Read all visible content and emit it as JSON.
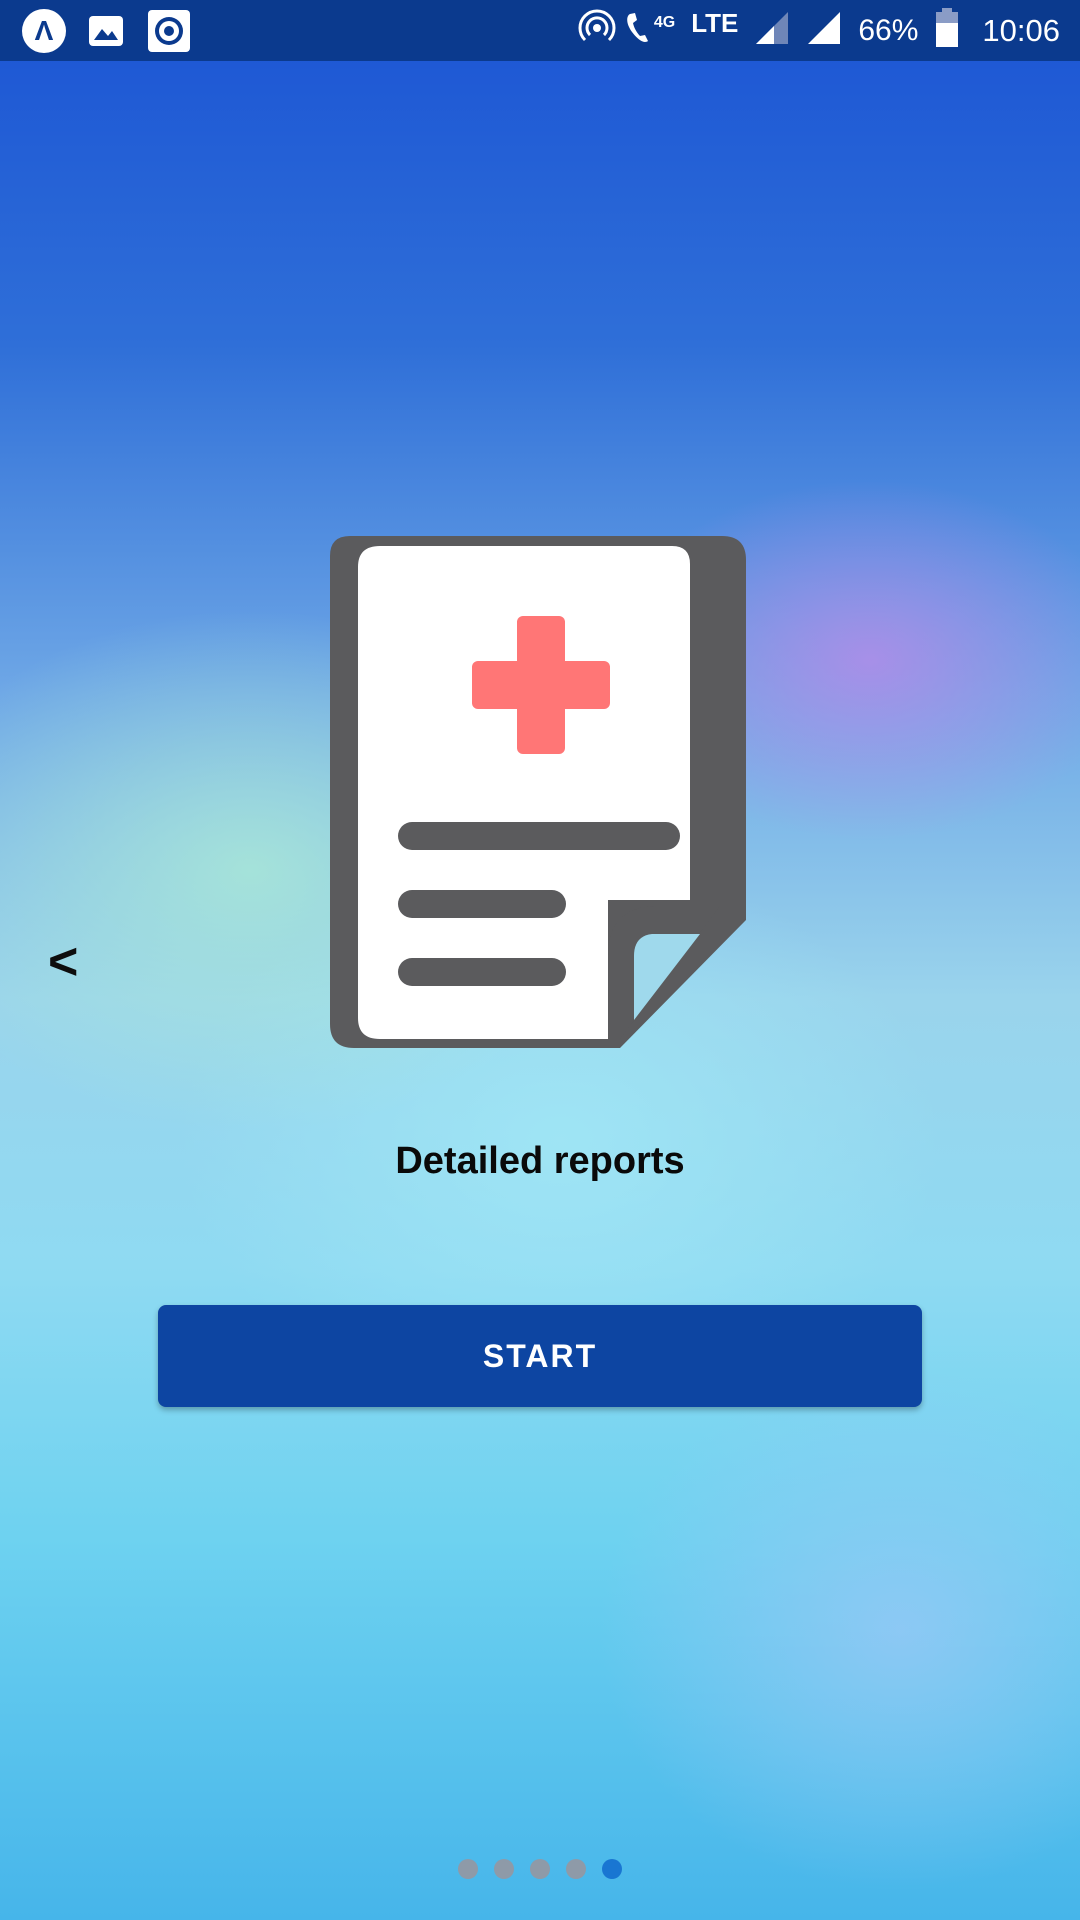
{
  "status_bar": {
    "left_icons": [
      "app-logo-icon",
      "gallery-icon",
      "record-icon"
    ],
    "app_logo_glyph": "Λ",
    "network_type": "4G",
    "network_label": "LTE",
    "battery": "66%",
    "time": "10:06"
  },
  "onboarding": {
    "back_label": "<",
    "illustration_icon": "medical-report-icon",
    "headline": "Detailed reports",
    "start_label": "START",
    "pages_total": 5,
    "current_page": 5
  },
  "colors": {
    "status_bar": "#0b3a8e",
    "button": "#0d45a2",
    "report_outline": "#5b5b5d",
    "medical_cross": "#ff7676",
    "page_fold": "#9fd9ec",
    "dot_active": "#1976d2",
    "dot_inactive": "#8e9aa8"
  }
}
